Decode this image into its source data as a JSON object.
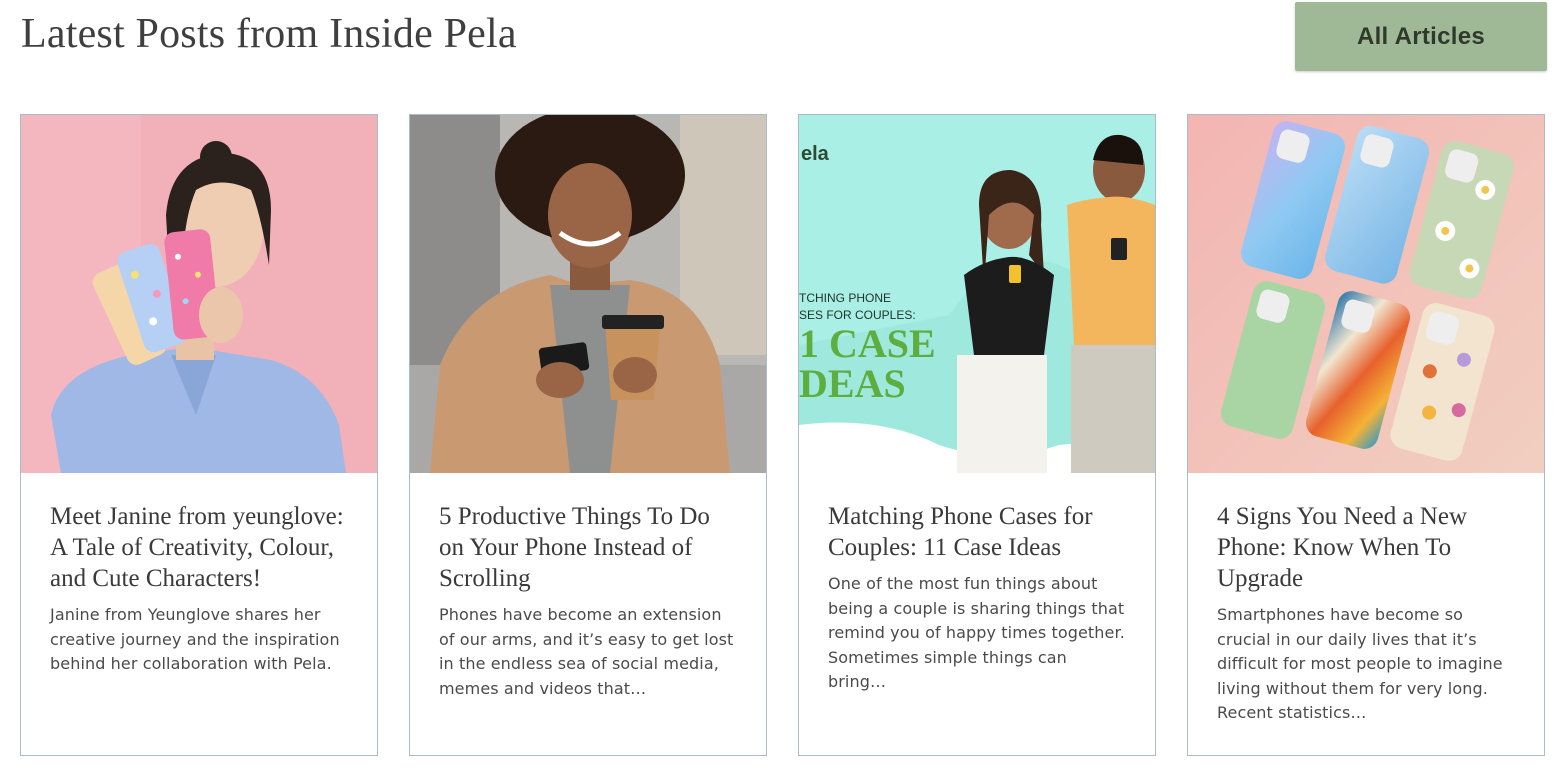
{
  "header": {
    "title": "Latest Posts from Inside Pela",
    "all_articles_label": "All Articles"
  },
  "colors": {
    "button_bg": "#9fb996",
    "card_border": "#a9bdc7",
    "text": "#3a3a3a"
  },
  "posts": [
    {
      "title": "Meet Janine from yeunglove: A Tale of Creativity, Colour, and Cute Characters!",
      "excerpt": "Janine from Yeunglove shares her creative journey and the inspiration behind her collaboration with Pela."
    },
    {
      "title": "5 Productive Things To Do on Your Phone Instead of Scrolling",
      "excerpt": "Phones have become an extension of our arms, and it’s easy to get lost in the endless sea of social media, memes and videos that…"
    },
    {
      "title": "Matching Phone Cases for Couples: 11 Case Ideas",
      "excerpt": "One of the most fun things about being a couple is sharing things that remind you of happy times together. Sometimes simple things can bring…",
      "image_text": {
        "brand": "ela",
        "line1": "TCHING PHONE",
        "line2": "SES FOR COUPLES:",
        "big1": "1 CASE",
        "big2": "DEAS"
      }
    },
    {
      "title": "4 Signs You Need a New Phone: Know When To Upgrade",
      "excerpt": "Smartphones have become so crucial in our daily lives that it’s difficult for most people to imagine living without them for very long. Recent statistics…"
    }
  ]
}
